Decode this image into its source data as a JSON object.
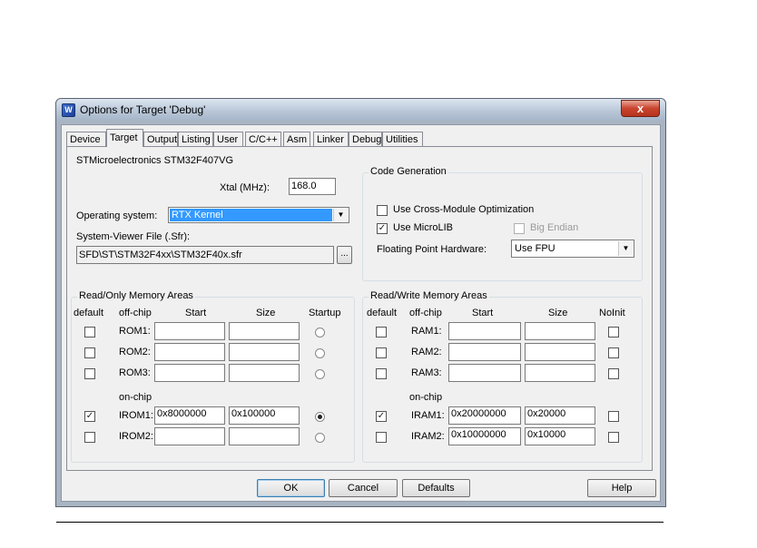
{
  "window": {
    "title": "Options for Target 'Debug'",
    "app_icon": "keil-uvision-icon",
    "close_glyph": "x"
  },
  "tabs": [
    "Device",
    "Target",
    "Output",
    "Listing",
    "User",
    "C/C++",
    "Asm",
    "Linker",
    "Debug",
    "Utilities"
  ],
  "active_tab": "Target",
  "device_name": "STMicroelectronics STM32F407VG",
  "xtal": {
    "label": "Xtal (MHz):",
    "value": "168.0"
  },
  "os": {
    "label": "Operating system:",
    "value": "RTX Kernel"
  },
  "svf": {
    "label": "System-Viewer File (.Sfr):",
    "value": "SFD\\ST\\STM32F4xx\\STM32F40x.sfr",
    "browse_label": "..."
  },
  "codegen": {
    "title": "Code Generation",
    "cross_module_label": "Use Cross-Module Optimization",
    "cross_module_checked": false,
    "microlib_label": "Use MicroLIB",
    "microlib_checked": true,
    "big_endian_label": "Big Endian",
    "big_endian_checked": false,
    "fpu_label": "Floating Point Hardware:",
    "fpu_value": "Use FPU"
  },
  "rom": {
    "title": "Read/Only Memory Areas",
    "headers": {
      "default": "default",
      "offchip": "off-chip",
      "start": "Start",
      "size": "Size",
      "startup": "Startup"
    },
    "onchip_label": "on-chip",
    "rows": [
      {
        "name": "ROM1:",
        "default": false,
        "start": "",
        "size": "",
        "startup": false
      },
      {
        "name": "ROM2:",
        "default": false,
        "start": "",
        "size": "",
        "startup": false
      },
      {
        "name": "ROM3:",
        "default": false,
        "start": "",
        "size": "",
        "startup": false
      },
      {
        "name": "IROM1:",
        "default": true,
        "start": "0x8000000",
        "size": "0x100000",
        "startup": true
      },
      {
        "name": "IROM2:",
        "default": false,
        "start": "",
        "size": "",
        "startup": false
      }
    ]
  },
  "ram": {
    "title": "Read/Write Memory Areas",
    "headers": {
      "default": "default",
      "offchip": "off-chip",
      "start": "Start",
      "size": "Size",
      "noinit": "NoInit"
    },
    "onchip_label": "on-chip",
    "rows": [
      {
        "name": "RAM1:",
        "default": false,
        "start": "",
        "size": "",
        "noinit": false
      },
      {
        "name": "RAM2:",
        "default": false,
        "start": "",
        "size": "",
        "noinit": false
      },
      {
        "name": "RAM3:",
        "default": false,
        "start": "",
        "size": "",
        "noinit": false
      },
      {
        "name": "IRAM1:",
        "default": true,
        "start": "0x20000000",
        "size": "0x20000",
        "noinit": false
      },
      {
        "name": "IRAM2:",
        "default": false,
        "start": "0x10000000",
        "size": "0x10000",
        "noinit": false
      }
    ]
  },
  "buttons": {
    "ok": "OK",
    "cancel": "Cancel",
    "defaults": "Defaults",
    "help": "Help"
  },
  "marks": {
    "check": "✓",
    "dropdown": "▼"
  }
}
